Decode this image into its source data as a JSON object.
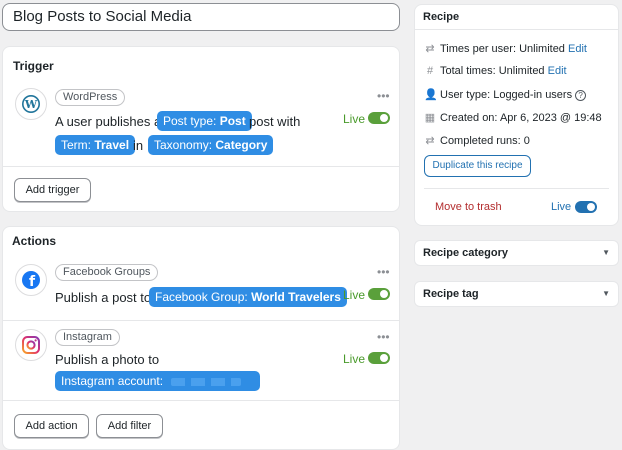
{
  "recipe_title": "Blog Posts to Social Media",
  "trigger": {
    "heading": "Trigger",
    "integration": "WordPress",
    "text_1": "A user publishes a",
    "token_post_key": "Post type:",
    "token_post_val": "Post",
    "text_2": "post with",
    "token_term_key": "Term:",
    "token_term_val": "Travel",
    "text_3": "in",
    "token_tax_key": "Taxonomy:",
    "token_tax_val": "Category",
    "status": "Live",
    "add_button": "Add trigger"
  },
  "actions": {
    "heading": "Actions",
    "items": [
      {
        "integration": "Facebook Groups",
        "text": "Publish a post to",
        "token_key": "Facebook Group:",
        "token_val": "World Travelers",
        "status": "Live"
      },
      {
        "integration": "Instagram",
        "text": "Publish a photo to",
        "token_key": "Instagram account:",
        "token_val": "",
        "status": "Live"
      }
    ],
    "add_action": "Add action",
    "add_filter": "Add filter"
  },
  "recipe_panel": {
    "heading": "Recipe",
    "times_per_user_label": "Times per user:",
    "times_per_user_value": "Unlimited",
    "edit": "Edit",
    "total_times_label": "Total times:",
    "total_times_value": "Unlimited",
    "user_type_label": "User type:",
    "user_type_value": "Logged-in users",
    "created_label": "Created on:",
    "created_value": "Apr 6, 2023 @ 19:48",
    "completed_label": "Completed runs:",
    "completed_value": "0",
    "duplicate_button": "Duplicate this recipe",
    "trash": "Move to trash",
    "status": "Live"
  },
  "recipe_category": "Recipe category",
  "recipe_tag": "Recipe tag",
  "colors": {
    "token_blue": "#2f8de4",
    "live_green": "#4a9a2b",
    "link_blue": "#2271b1",
    "trash_red": "#b32d2e"
  }
}
